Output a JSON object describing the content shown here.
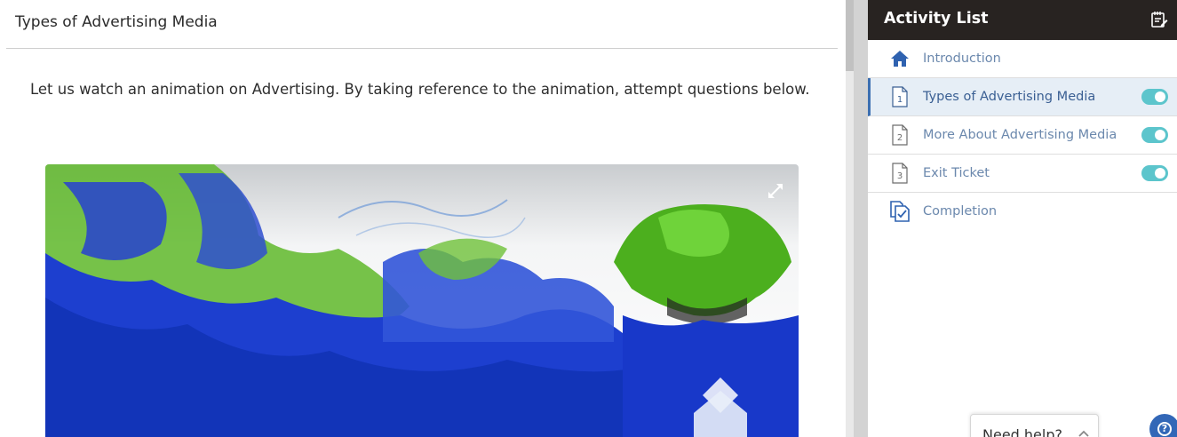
{
  "main": {
    "title": "Types of Advertising Media",
    "intro": "Let us watch an animation on Advertising. By taking reference to the animation, attempt questions below."
  },
  "sidebar": {
    "title": "Activity List",
    "items": [
      {
        "label": "Introduction",
        "icon": "home-icon",
        "toggle": false,
        "active": false
      },
      {
        "label": "Types of Advertising Media",
        "icon": "page-1-icon",
        "toggle": true,
        "active": true
      },
      {
        "label": "More About Advertising Media",
        "icon": "page-2-icon",
        "toggle": true,
        "active": false
      },
      {
        "label": "Exit Ticket",
        "icon": "page-3-icon",
        "toggle": true,
        "active": false
      },
      {
        "label": "Completion",
        "icon": "completion-icon",
        "toggle": false,
        "active": false
      }
    ]
  },
  "help": {
    "label": "Need help?"
  },
  "colors": {
    "accent": "#3b6fb1",
    "toggle": "#5cc5cc",
    "header_bg": "#282321",
    "active_row": "#e6eef6"
  }
}
